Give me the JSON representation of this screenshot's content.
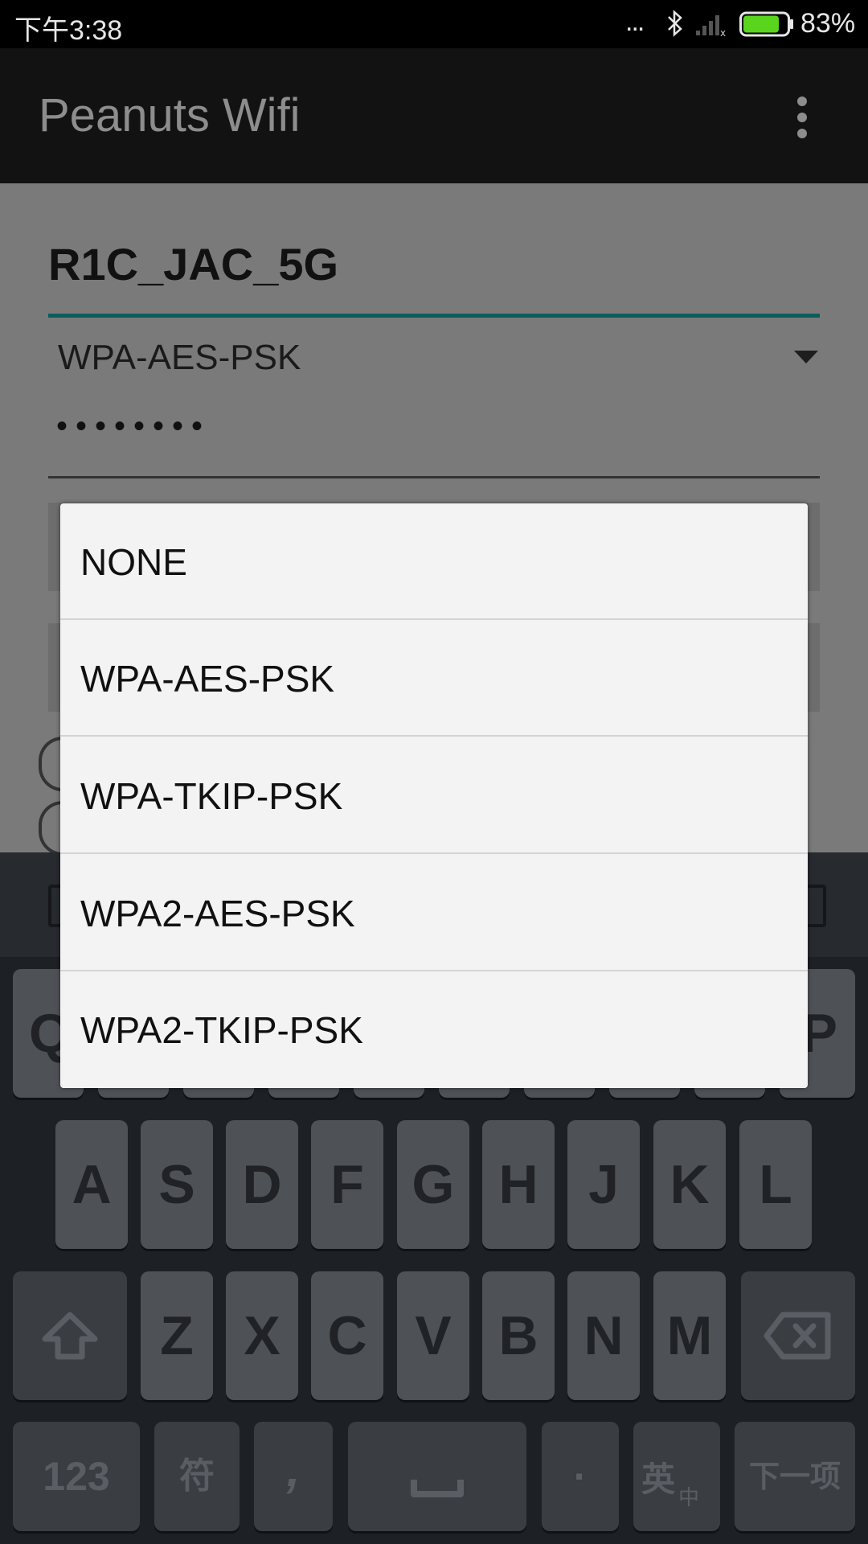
{
  "status_bar": {
    "time": "下午3:38",
    "more": "...",
    "battery_percent": "83%",
    "battery_level": 0.83,
    "battery_color": "#59d51e",
    "icons": [
      "bluetooth-icon",
      "signal-icon",
      "battery-icon"
    ]
  },
  "app_bar": {
    "title": "Peanuts Wifi",
    "overflow_icon": "more-vert-icon"
  },
  "form": {
    "ssid": "R1C_JAC_5G",
    "security_selected": "WPA-AES-PSK",
    "password_masked": "••••••••",
    "accent_color": "#0b5d5b"
  },
  "dialog": {
    "options": [
      {
        "label": "NONE"
      },
      {
        "label": "WPA-AES-PSK"
      },
      {
        "label": "WPA-TKIP-PSK"
      },
      {
        "label": "WPA2-AES-PSK"
      },
      {
        "label": "WPA2-TKIP-PSK"
      }
    ]
  },
  "keyboard": {
    "row1_visible": [
      "Q",
      "P"
    ],
    "row2": [
      "A",
      "S",
      "D",
      "F",
      "G",
      "H",
      "J",
      "K",
      "L"
    ],
    "row3": [
      "Z",
      "X",
      "C",
      "V",
      "B",
      "N",
      "M"
    ],
    "numbers_label": "123",
    "symbols_label": "符",
    "comma_label": ",",
    "period_label": "·",
    "lang_label_main": "英",
    "lang_label_sub": "中",
    "enter_label": "下一项"
  }
}
